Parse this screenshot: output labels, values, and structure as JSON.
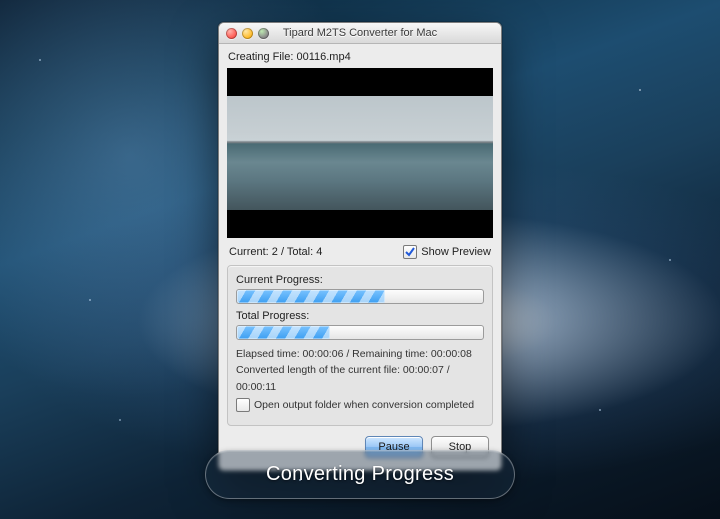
{
  "window": {
    "title": "Tipard M2TS Converter for Mac",
    "creating_file_label": "Creating File: 00116.mp4",
    "counter_text": "Current: 2 / Total: 4",
    "show_preview_label": "Show Preview",
    "show_preview_checked": true
  },
  "progress": {
    "current_label": "Current Progress:",
    "current_pct": 60,
    "total_label": "Total Progress:",
    "total_pct": 38,
    "elapsed_remaining": "Elapsed time: 00:00:06 / Remaining time: 00:00:08",
    "converted_length": "Converted length of the current file: 00:00:07 / 00:00:11",
    "open_folder_label": "Open output folder when conversion completed",
    "open_folder_checked": false
  },
  "buttons": {
    "pause": "Pause",
    "stop": "Stop"
  },
  "caption": "Converting Progress"
}
